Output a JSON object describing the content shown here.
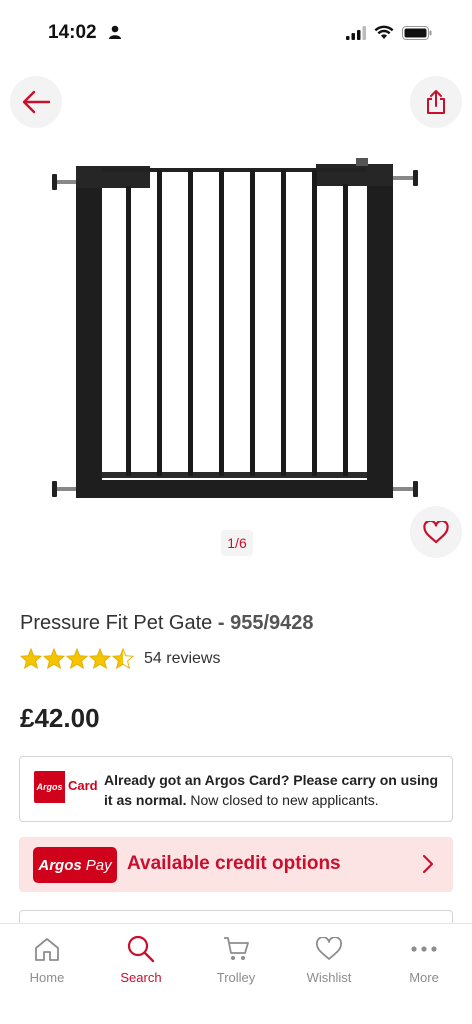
{
  "status": {
    "time": "14:02"
  },
  "gallery": {
    "pager": "1/6"
  },
  "product": {
    "name": "Pressure Fit Pet Gate",
    "separator": " - ",
    "sku": "955/9428",
    "rating_stars": 4.5,
    "reviews": "54 reviews",
    "price": "£42.00"
  },
  "argos_card": {
    "logo_text": "Argos",
    "logo_word": "Card",
    "bold_text": "Already got an Argos Card? Please carry on using it as normal.",
    "normal_text": " Now closed to new applicants."
  },
  "argos_pay": {
    "logo_text": "Argos",
    "logo_pay": "Pay",
    "label": "Available credit options"
  },
  "tabbar": {
    "home": "Home",
    "search": "Search",
    "trolley": "Trolley",
    "wishlist": "Wishlist",
    "more": "More"
  },
  "colors": {
    "brand_red": "#c8102e",
    "star": "#f5c400",
    "pay_bg": "#fde4e4"
  }
}
